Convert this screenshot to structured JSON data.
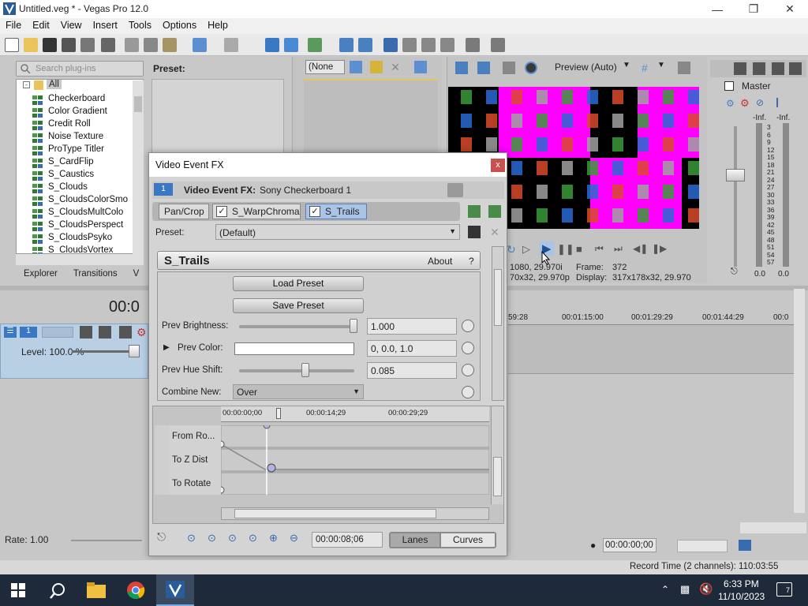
{
  "window": {
    "title": "Untitled.veg * - Vegas Pro 12.0"
  },
  "menu": [
    "File",
    "Edit",
    "View",
    "Insert",
    "Tools",
    "Options",
    "Help"
  ],
  "plugins": {
    "search_placeholder": "Search plug-ins",
    "root": "All",
    "items": [
      "Checkerboard",
      "Color Gradient",
      "Credit Roll",
      "Noise Texture",
      "ProType Titler",
      "S_CardFlip",
      "S_Caustics",
      "S_Clouds",
      "S_CloudsColorSmo",
      "S_CloudsMultColo",
      "S_CloudsPerspect",
      "S_CloudsPsyko",
      "S_CloudsVortex"
    ],
    "tabs": [
      "Explorer",
      "Transitions",
      "V"
    ]
  },
  "preset_panel": {
    "label": "Preset:"
  },
  "trimmer": {
    "combo_value": "(None"
  },
  "preview": {
    "mode": "Preview (Auto)",
    "info_left_1": "1080, 29.970i",
    "info_left_2": "70x32, 29.970p",
    "frame_label": "Frame:",
    "frame_value": "372",
    "display_label": "Display:",
    "display_value": "317x178x32, 29.970"
  },
  "master": {
    "label": "Master",
    "inf_left": "-Inf.",
    "inf_right": "-Inf.",
    "scale": [
      "3",
      "6",
      "9",
      "12",
      "15",
      "18",
      "21",
      "24",
      "27",
      "30",
      "33",
      "36",
      "39",
      "42",
      "45",
      "48",
      "51",
      "54",
      "57"
    ],
    "bottom_left": "0.0",
    "bottom_right": "0.0"
  },
  "timeline": {
    "time_display": "00:0",
    "track_number": "1",
    "level": "Level: 100.0 %",
    "ruler": [
      "59:28",
      "00:01:15:00",
      "00:01:29:29",
      "00:01:44:29",
      "00:0"
    ],
    "rate": "Rate: 1.00",
    "cursor_time": "00:00:00;00",
    "record_time": "Record Time (2 channels): 110:03:55"
  },
  "dialog": {
    "title": "Video Event FX",
    "close": "x",
    "chain_number": "1",
    "header_label": "Video Event FX:",
    "header_value": "Sony Checkerboard 1",
    "chain": [
      "Pan/Crop",
      "S_WarpChroma",
      "S_Trails"
    ],
    "preset_label": "Preset:",
    "preset_value": "(Default)",
    "plugin_name": "S_Trails",
    "about": "About",
    "help": "?",
    "load_preset": "Load Preset",
    "save_preset": "Save Preset",
    "params": [
      {
        "label": "Prev Brightness:",
        "value": "1.000",
        "level": 1.0
      },
      {
        "label": "Prev Color:",
        "value": "0, 0.0, 1.0"
      },
      {
        "label": "Prev Hue Shift:",
        "value": "0.085",
        "level": 0.58
      },
      {
        "label": "Combine New:",
        "value": "Over"
      }
    ],
    "kf_ruler": [
      "00:00:00;00",
      "00:00:14;29",
      "00:00:29;29"
    ],
    "kf_tracks": [
      "From Ro...",
      "To Z Dist",
      "To Rotate"
    ],
    "kf_time": "00:00:08;06",
    "view_lanes": "Lanes",
    "view_curves": "Curves"
  },
  "taskbar": {
    "time": "6:33 PM",
    "date": "11/10/2023",
    "notifications": "7"
  },
  "colors": {
    "accent": "#3a78c4",
    "magenta": "#ff00ff",
    "taskbar": "#1e2a3a"
  }
}
